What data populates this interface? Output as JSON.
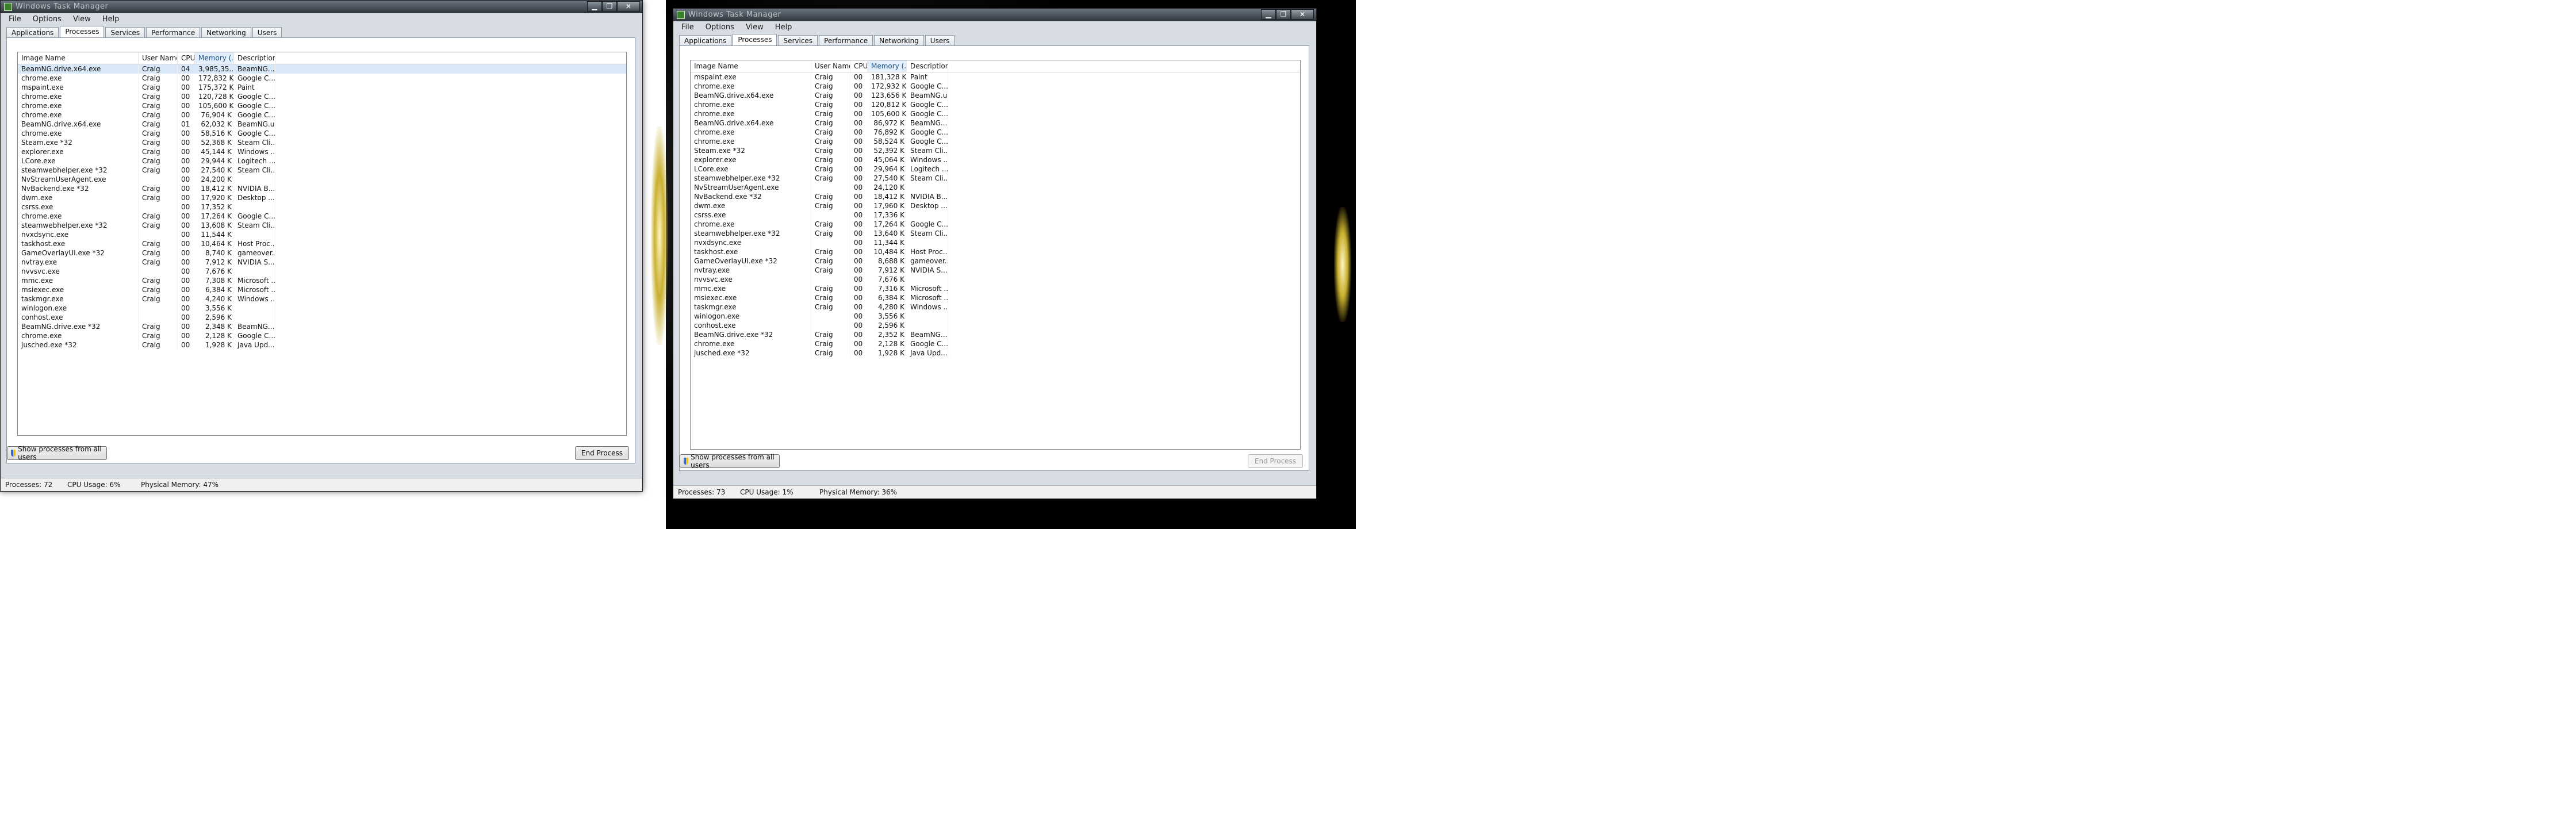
{
  "app_title": "Windows Task Manager",
  "menu": [
    "File",
    "Options",
    "View",
    "Help"
  ],
  "tabs": [
    "Applications",
    "Processes",
    "Services",
    "Performance",
    "Networking",
    "Users"
  ],
  "columns": [
    "Image Name",
    "User Name",
    "CPU",
    "Memory (...",
    "Description"
  ],
  "caption": {
    "minimize": "▁",
    "maximize": "❐",
    "close": "✕"
  },
  "window1": {
    "rows": [
      {
        "name": "BeamNG.drive.x64.exe",
        "user": "Craig",
        "cpu": "04",
        "mem": "3,985,35...",
        "desc": "BeamNG...."
      },
      {
        "name": "chrome.exe",
        "user": "Craig",
        "cpu": "00",
        "mem": "172,832 K",
        "desc": "Google C..."
      },
      {
        "name": "mspaint.exe",
        "user": "Craig",
        "cpu": "00",
        "mem": "175,372 K",
        "desc": "Paint"
      },
      {
        "name": "chrome.exe",
        "user": "Craig",
        "cpu": "00",
        "mem": "120,728 K",
        "desc": "Google C..."
      },
      {
        "name": "chrome.exe",
        "user": "Craig",
        "cpu": "00",
        "mem": "105,600 K",
        "desc": "Google C..."
      },
      {
        "name": "chrome.exe",
        "user": "Craig",
        "cpu": "00",
        "mem": "76,904 K",
        "desc": "Google C..."
      },
      {
        "name": "BeamNG.drive.x64.exe",
        "user": "Craig",
        "cpu": "01",
        "mem": "62,032 K",
        "desc": "BeamNG.u..."
      },
      {
        "name": "chrome.exe",
        "user": "Craig",
        "cpu": "00",
        "mem": "58,516 K",
        "desc": "Google C..."
      },
      {
        "name": "Steam.exe *32",
        "user": "Craig",
        "cpu": "00",
        "mem": "52,368 K",
        "desc": "Steam Cli..."
      },
      {
        "name": "explorer.exe",
        "user": "Craig",
        "cpu": "00",
        "mem": "45,144 K",
        "desc": "Windows ..."
      },
      {
        "name": "LCore.exe",
        "user": "Craig",
        "cpu": "00",
        "mem": "29,944 K",
        "desc": "Logitech ..."
      },
      {
        "name": "steamwebhelper.exe *32",
        "user": "Craig",
        "cpu": "00",
        "mem": "27,540 K",
        "desc": "Steam Cli..."
      },
      {
        "name": "NvStreamUserAgent.exe",
        "user": "",
        "cpu": "00",
        "mem": "24,200 K",
        "desc": ""
      },
      {
        "name": "NvBackend.exe *32",
        "user": "Craig",
        "cpu": "00",
        "mem": "18,412 K",
        "desc": "NVIDIA B..."
      },
      {
        "name": "dwm.exe",
        "user": "Craig",
        "cpu": "00",
        "mem": "17,920 K",
        "desc": "Desktop ..."
      },
      {
        "name": "csrss.exe",
        "user": "",
        "cpu": "00",
        "mem": "17,352 K",
        "desc": ""
      },
      {
        "name": "chrome.exe",
        "user": "Craig",
        "cpu": "00",
        "mem": "17,264 K",
        "desc": "Google C..."
      },
      {
        "name": "steamwebhelper.exe *32",
        "user": "Craig",
        "cpu": "00",
        "mem": "13,608 K",
        "desc": "Steam Cli..."
      },
      {
        "name": "nvxdsync.exe",
        "user": "",
        "cpu": "00",
        "mem": "11,544 K",
        "desc": ""
      },
      {
        "name": "taskhost.exe",
        "user": "Craig",
        "cpu": "00",
        "mem": "10,464 K",
        "desc": "Host Proc..."
      },
      {
        "name": "GameOverlayUI.exe *32",
        "user": "Craig",
        "cpu": "00",
        "mem": "8,740 K",
        "desc": "gameover..."
      },
      {
        "name": "nvtray.exe",
        "user": "Craig",
        "cpu": "00",
        "mem": "7,912 K",
        "desc": "NVIDIA S..."
      },
      {
        "name": "nvvsvc.exe",
        "user": "",
        "cpu": "00",
        "mem": "7,676 K",
        "desc": ""
      },
      {
        "name": "mmc.exe",
        "user": "Craig",
        "cpu": "00",
        "mem": "7,308 K",
        "desc": "Microsoft ..."
      },
      {
        "name": "msiexec.exe",
        "user": "Craig",
        "cpu": "00",
        "mem": "6,384 K",
        "desc": "Microsoft ..."
      },
      {
        "name": "taskmgr.exe",
        "user": "Craig",
        "cpu": "00",
        "mem": "4,240 K",
        "desc": "Windows ..."
      },
      {
        "name": "winlogon.exe",
        "user": "",
        "cpu": "00",
        "mem": "3,556 K",
        "desc": ""
      },
      {
        "name": "conhost.exe",
        "user": "",
        "cpu": "00",
        "mem": "2,596 K",
        "desc": ""
      },
      {
        "name": "BeamNG.drive.exe *32",
        "user": "Craig",
        "cpu": "00",
        "mem": "2,348 K",
        "desc": "BeamNG...."
      },
      {
        "name": "chrome.exe",
        "user": "Craig",
        "cpu": "00",
        "mem": "2,128 K",
        "desc": "Google C..."
      },
      {
        "name": "jusched.exe *32",
        "user": "Craig",
        "cpu": "00",
        "mem": "1,928 K",
        "desc": "Java Upd..."
      }
    ],
    "show_all_label": "Show processes from all users",
    "end_process_label": "End Process",
    "status": {
      "processes": "Processes: 72",
      "cpu": "CPU Usage: 6%",
      "memory": "Physical Memory: 47%"
    }
  },
  "window2": {
    "rows": [
      {
        "name": "mspaint.exe",
        "user": "Craig",
        "cpu": "00",
        "mem": "181,328 K",
        "desc": "Paint"
      },
      {
        "name": "chrome.exe",
        "user": "Craig",
        "cpu": "00",
        "mem": "172,932 K",
        "desc": "Google C..."
      },
      {
        "name": "BeamNG.drive.x64.exe",
        "user": "Craig",
        "cpu": "00",
        "mem": "123,656 K",
        "desc": "BeamNG.u..."
      },
      {
        "name": "chrome.exe",
        "user": "Craig",
        "cpu": "00",
        "mem": "120,812 K",
        "desc": "Google C..."
      },
      {
        "name": "chrome.exe",
        "user": "Craig",
        "cpu": "00",
        "mem": "105,600 K",
        "desc": "Google C..."
      },
      {
        "name": "BeamNG.drive.x64.exe",
        "user": "Craig",
        "cpu": "00",
        "mem": "86,972 K",
        "desc": "BeamNG...."
      },
      {
        "name": "chrome.exe",
        "user": "Craig",
        "cpu": "00",
        "mem": "76,892 K",
        "desc": "Google C..."
      },
      {
        "name": "chrome.exe",
        "user": "Craig",
        "cpu": "00",
        "mem": "58,524 K",
        "desc": "Google C..."
      },
      {
        "name": "Steam.exe *32",
        "user": "Craig",
        "cpu": "00",
        "mem": "52,392 K",
        "desc": "Steam Cli..."
      },
      {
        "name": "explorer.exe",
        "user": "Craig",
        "cpu": "00",
        "mem": "45,064 K",
        "desc": "Windows ..."
      },
      {
        "name": "LCore.exe",
        "user": "Craig",
        "cpu": "00",
        "mem": "29,964 K",
        "desc": "Logitech ..."
      },
      {
        "name": "steamwebhelper.exe *32",
        "user": "Craig",
        "cpu": "00",
        "mem": "27,540 K",
        "desc": "Steam Cli..."
      },
      {
        "name": "NvStreamUserAgent.exe",
        "user": "",
        "cpu": "00",
        "mem": "24,120 K",
        "desc": ""
      },
      {
        "name": "NvBackend.exe *32",
        "user": "Craig",
        "cpu": "00",
        "mem": "18,412 K",
        "desc": "NVIDIA B..."
      },
      {
        "name": "dwm.exe",
        "user": "Craig",
        "cpu": "00",
        "mem": "17,960 K",
        "desc": "Desktop ..."
      },
      {
        "name": "csrss.exe",
        "user": "",
        "cpu": "00",
        "mem": "17,336 K",
        "desc": ""
      },
      {
        "name": "chrome.exe",
        "user": "Craig",
        "cpu": "00",
        "mem": "17,264 K",
        "desc": "Google C..."
      },
      {
        "name": "steamwebhelper.exe *32",
        "user": "Craig",
        "cpu": "00",
        "mem": "13,640 K",
        "desc": "Steam Cli..."
      },
      {
        "name": "nvxdsync.exe",
        "user": "",
        "cpu": "00",
        "mem": "11,344 K",
        "desc": ""
      },
      {
        "name": "taskhost.exe",
        "user": "Craig",
        "cpu": "00",
        "mem": "10,484 K",
        "desc": "Host Proc..."
      },
      {
        "name": "GameOverlayUI.exe *32",
        "user": "Craig",
        "cpu": "00",
        "mem": "8,688 K",
        "desc": "gameover..."
      },
      {
        "name": "nvtray.exe",
        "user": "Craig",
        "cpu": "00",
        "mem": "7,912 K",
        "desc": "NVIDIA S..."
      },
      {
        "name": "nvvsvc.exe",
        "user": "",
        "cpu": "00",
        "mem": "7,676 K",
        "desc": ""
      },
      {
        "name": "mmc.exe",
        "user": "Craig",
        "cpu": "00",
        "mem": "7,316 K",
        "desc": "Microsoft ..."
      },
      {
        "name": "msiexec.exe",
        "user": "Craig",
        "cpu": "00",
        "mem": "6,384 K",
        "desc": "Microsoft ..."
      },
      {
        "name": "taskmgr.exe",
        "user": "Craig",
        "cpu": "00",
        "mem": "4,280 K",
        "desc": "Windows ..."
      },
      {
        "name": "winlogon.exe",
        "user": "",
        "cpu": "00",
        "mem": "3,556 K",
        "desc": ""
      },
      {
        "name": "conhost.exe",
        "user": "",
        "cpu": "00",
        "mem": "2,596 K",
        "desc": ""
      },
      {
        "name": "BeamNG.drive.exe *32",
        "user": "Craig",
        "cpu": "00",
        "mem": "2,352 K",
        "desc": "BeamNG...."
      },
      {
        "name": "chrome.exe",
        "user": "Craig",
        "cpu": "00",
        "mem": "2,128 K",
        "desc": "Google C..."
      },
      {
        "name": "jusched.exe *32",
        "user": "Craig",
        "cpu": "00",
        "mem": "1,928 K",
        "desc": "Java Upd..."
      }
    ],
    "show_all_label": "Show processes from all users",
    "end_process_label": "End Process",
    "status": {
      "processes": "Processes: 73",
      "cpu": "CPU Usage: 1%",
      "memory": "Physical Memory: 36%"
    }
  }
}
